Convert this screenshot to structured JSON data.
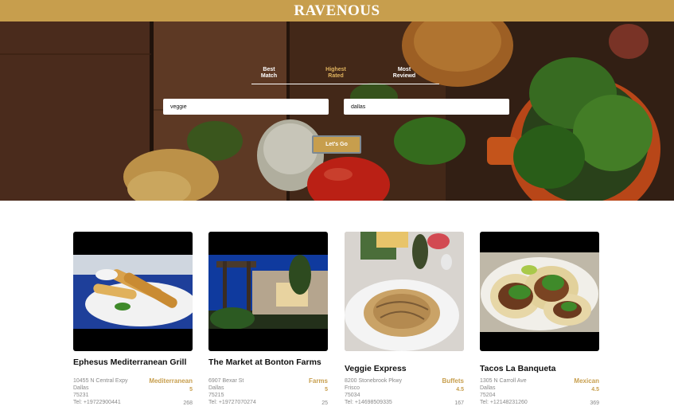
{
  "app": {
    "brand": "RAVENOUS"
  },
  "sort": {
    "tabs": [
      {
        "line1": "Best",
        "line2": "Match",
        "active": false
      },
      {
        "line1": "Highest",
        "line2": "Rated",
        "active": true
      },
      {
        "line1": "Most",
        "line2": "Reviewd",
        "active": false
      }
    ]
  },
  "search": {
    "term_value": "veggie",
    "location_value": "dallas",
    "button_label": "Let's Go"
  },
  "colors": {
    "accent": "#c79e4d",
    "header": "#c79e4d"
  },
  "businesses": [
    {
      "name": "Ephesus Mediterranean Grill",
      "address": "10455 N Central Expy",
      "city": "Dallas",
      "zip": "75231",
      "phone": "Tel: +19722900441",
      "category": "Mediterranean",
      "rating": "5",
      "reviews": "268",
      "photo_icon": "spring-rolls-photo"
    },
    {
      "name": "The Market at Bonton Farms",
      "address": "6907 Bexar St",
      "city": "Dallas",
      "zip": "75215",
      "phone": "Tel: +19727070274",
      "category": "Farms",
      "rating": "5",
      "reviews": "25",
      "photo_icon": "storefront-photo"
    },
    {
      "name": "Veggie Express",
      "address": "8200 Stonebrook Pkwy",
      "city": "Frisco",
      "zip": "75034",
      "phone": "Tel: +14698509335",
      "category": "Buffets",
      "rating": "4.5",
      "reviews": "167",
      "photo_icon": "noodles-photo"
    },
    {
      "name": "Tacos La Banqueta",
      "address": "1305 N Carroll Ave",
      "city": "Dallas",
      "zip": "75204",
      "phone": "Tel: +12148231260",
      "category": "Mexican",
      "rating": "4.5",
      "reviews": "369",
      "photo_icon": "tacos-photo"
    }
  ]
}
